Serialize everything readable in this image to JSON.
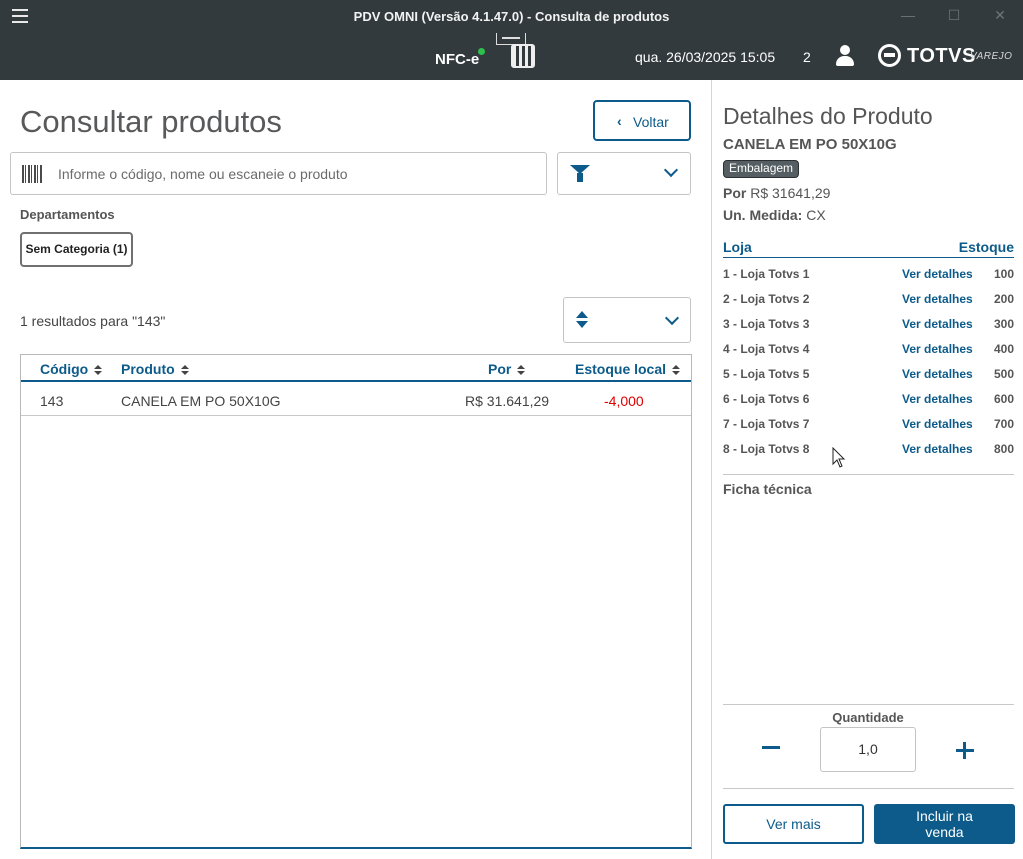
{
  "window": {
    "title": "PDV OMNI (Versão 4.1.47.0) - Consulta de produtos",
    "minimize": "—",
    "maximize": "☐",
    "close": "✕"
  },
  "header": {
    "doc_type": "NFC-e",
    "datetime": "qua. 26/03/2025 15:05",
    "count": "2",
    "brand": "TOTVS",
    "brand_sub": "VAREJO",
    "status_color": "#2ec04d"
  },
  "main": {
    "title": "Consultar produtos",
    "back_label": "Voltar",
    "search_placeholder": "Informe o código, nome ou escaneie o produto",
    "departments_label": "Departamentos",
    "department_chip": "Sem Categoria (1)",
    "results_text": "1 resultados para \"143\"",
    "table": {
      "headers": [
        "Código",
        "Produto",
        "Por",
        "Estoque local"
      ],
      "rows": [
        {
          "codigo": "143",
          "produto": "CANELA EM PO 50X10G",
          "por": "R$ 31.641,29",
          "estoque": "-4,000"
        }
      ]
    }
  },
  "details": {
    "title": "Detalhes do Produto",
    "product_name": "CANELA EM PO 50X10G",
    "badge": "Embalagem",
    "price_label": "Por",
    "price_value": "R$ 31641,29",
    "unit_label": "Un. Medida:",
    "unit_value": "CX",
    "store_header": "Loja",
    "stock_header": "Estoque",
    "stores": [
      {
        "name": "1 - Loja Totvs 1",
        "link": "Ver detalhes",
        "qty": "100"
      },
      {
        "name": "2 - Loja Totvs 2",
        "link": "Ver detalhes",
        "qty": "200"
      },
      {
        "name": "3 - Loja Totvs 3",
        "link": "Ver detalhes",
        "qty": "300"
      },
      {
        "name": "4 - Loja Totvs 4",
        "link": "Ver detalhes",
        "qty": "400"
      },
      {
        "name": "5 - Loja Totvs 5",
        "link": "Ver detalhes",
        "qty": "500"
      },
      {
        "name": "6 - Loja Totvs 6",
        "link": "Ver detalhes",
        "qty": "600"
      },
      {
        "name": "7 - Loja Totvs 7",
        "link": "Ver detalhes",
        "qty": "700"
      },
      {
        "name": "8 - Loja Totvs 8",
        "link": "Ver detalhes",
        "qty": "800"
      }
    ],
    "ficha_label": "Ficha técnica",
    "quantity_label": "Quantidade",
    "quantity_value": "1,0",
    "more_button": "Ver mais",
    "add_button": "Incluir na venda"
  },
  "colors": {
    "primary": "#0c5b8a",
    "negative": "#e10000",
    "titlebar": "#323a3d"
  }
}
